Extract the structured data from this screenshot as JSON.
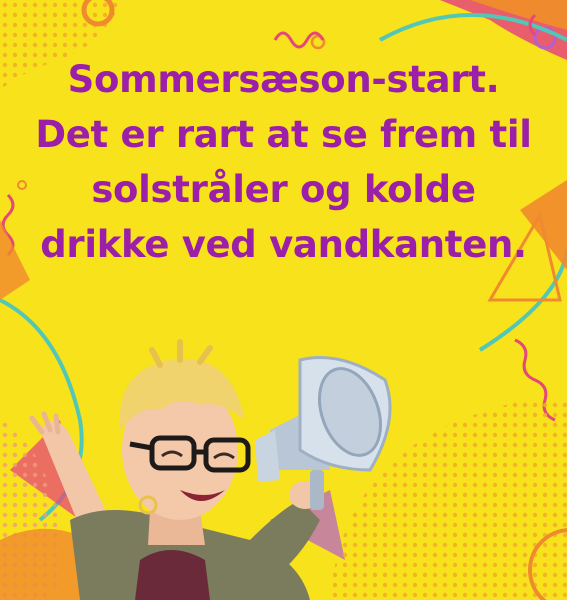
{
  "headline": {
    "lines": [
      "Sommersæson-start.",
      "Det er rart at se frem til",
      "solstråler og kolde",
      "drikke ved vandkanten."
    ],
    "color": "#9b1fa8"
  },
  "colors": {
    "background": "#f7e21b",
    "accent_orange": "#f08a2e",
    "accent_pink": "#e5477a",
    "accent_teal": "#53c7b6",
    "accent_purple": "#b25fcf"
  },
  "illustration": {
    "character": "cartoon-person-with-megaphone",
    "icon": "megaphone-icon"
  }
}
